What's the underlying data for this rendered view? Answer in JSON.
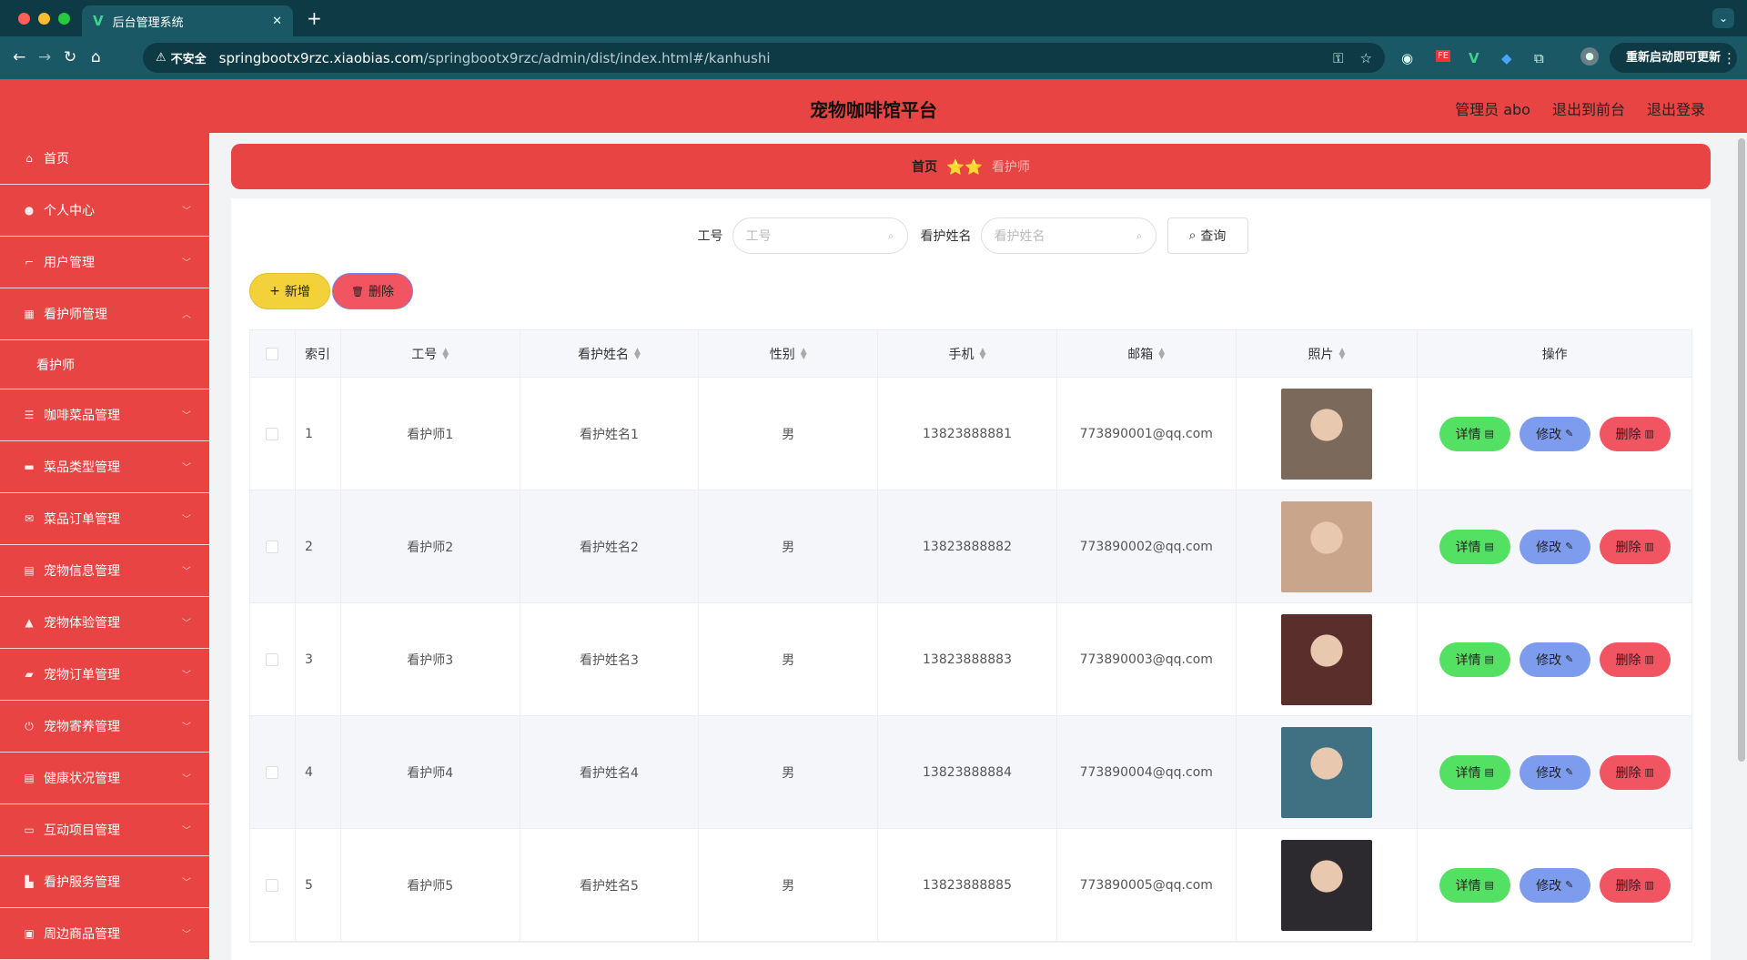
{
  "browser": {
    "tab_title": "后台管理系统",
    "tab_close": "✕",
    "new_tab": "+",
    "insecure_label": "不安全",
    "url_host": "springbootx9rzc.xiaobias.com",
    "url_path": "/springbootx9rzc/admin/dist/index.html#/kanhushi",
    "update_label": "重新启动即可更新",
    "colors": {
      "tabbar": "#0d3a44",
      "addrbar": "#1a5866"
    }
  },
  "header": {
    "title": "宠物咖啡馆平台",
    "admin_label": "管理员 abo",
    "to_front": "退出到前台",
    "logout": "退出登录",
    "color": "#e84443"
  },
  "sidebar": {
    "items": [
      {
        "label": "首页",
        "icon": "home-icon"
      },
      {
        "label": "个人中心",
        "icon": "user-icon"
      },
      {
        "label": "用户管理",
        "icon": "crop-icon"
      },
      {
        "label": "看护师管理",
        "icon": "grid-icon"
      },
      {
        "label": "看护师",
        "icon": ""
      },
      {
        "label": "咖啡菜品管理",
        "icon": "list-icon"
      },
      {
        "label": "菜品类型管理",
        "icon": "monitor-icon"
      },
      {
        "label": "菜品订单管理",
        "icon": "mail-icon"
      },
      {
        "label": "宠物信息管理",
        "icon": "doc-icon"
      },
      {
        "label": "宠物体验管理",
        "icon": "person-icon"
      },
      {
        "label": "宠物订单管理",
        "icon": "ticket-icon"
      },
      {
        "label": "宠物寄养管理",
        "icon": "power-icon"
      },
      {
        "label": "健康状况管理",
        "icon": "doc-icon"
      },
      {
        "label": "互动项目管理",
        "icon": "chat-icon"
      },
      {
        "label": "看护服务管理",
        "icon": "truck-icon"
      },
      {
        "label": "周边商品管理",
        "icon": "box-icon"
      }
    ]
  },
  "breadcrumb": {
    "home": "首页",
    "stars": "⭐⭐",
    "current": "看护师"
  },
  "search": {
    "label_no": "工号",
    "placeholder_no": "工号",
    "label_name": "看护姓名",
    "placeholder_name": "看护姓名",
    "query": "查询"
  },
  "actions": {
    "add": "新增",
    "delete": "删除"
  },
  "table": {
    "headers": [
      "索引",
      "工号",
      "看护姓名",
      "性别",
      "手机",
      "邮箱",
      "照片",
      "操作"
    ],
    "rows": [
      {
        "idx": "1",
        "no": "看护师1",
        "name": "看护姓名1",
        "sex": "男",
        "phone": "13823888881",
        "email": "773890001@qq.com",
        "photo": "#7b6a5c"
      },
      {
        "idx": "2",
        "no": "看护师2",
        "name": "看护姓名2",
        "sex": "男",
        "phone": "13823888882",
        "email": "773890002@qq.com",
        "photo": "#c9a58b"
      },
      {
        "idx": "3",
        "no": "看护师3",
        "name": "看护姓名3",
        "sex": "男",
        "phone": "13823888883",
        "email": "773890003@qq.com",
        "photo": "#5a2e2a"
      },
      {
        "idx": "4",
        "no": "看护师4",
        "name": "看护姓名4",
        "sex": "男",
        "phone": "13823888884",
        "email": "773890004@qq.com",
        "photo": "#3f7182"
      },
      {
        "idx": "5",
        "no": "看护师5",
        "name": "看护姓名5",
        "sex": "男",
        "phone": "13823888885",
        "email": "773890005@qq.com",
        "photo": "#2c2a2e"
      }
    ],
    "op_detail": "详情",
    "op_edit": "修改",
    "op_delete": "删除"
  }
}
